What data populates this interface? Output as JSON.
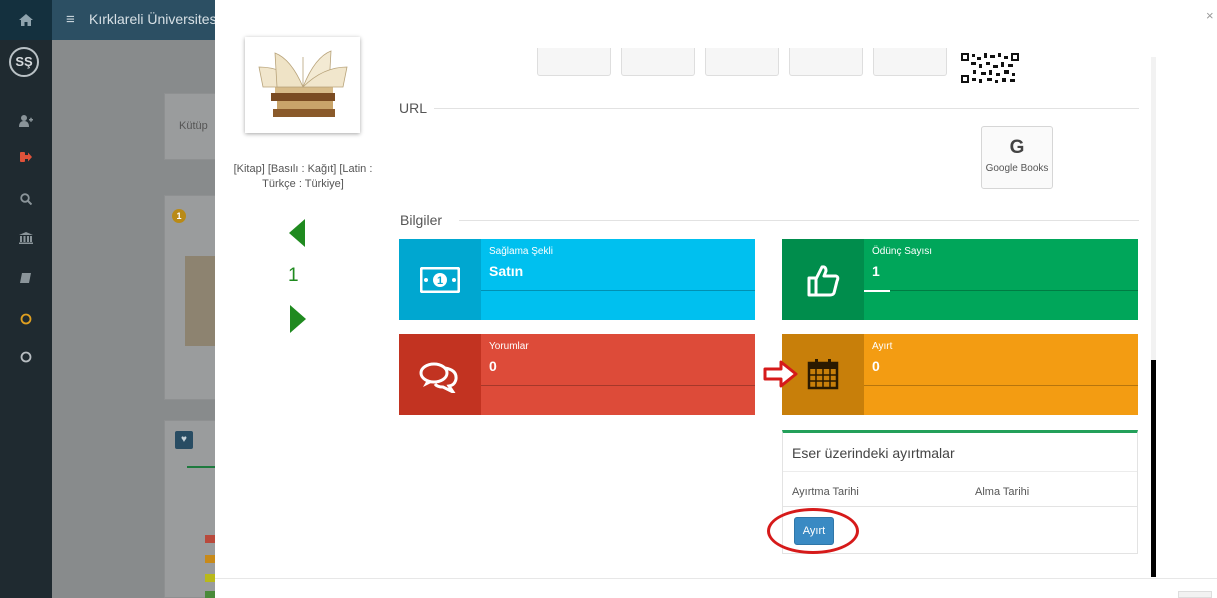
{
  "topbar": {
    "home_icon": "home-icon",
    "menu_icon": "hamburger-icon",
    "title": "Kırklareli Üniversitesi"
  },
  "sidebar": {
    "logo_text": "SŞ",
    "icons": [
      "add-user-icon",
      "logout-icon",
      "search-icon",
      "institution-icon",
      "book-icon",
      "circle-icon",
      "circle-icon"
    ],
    "icon_colors": [
      "#8a9499",
      "#e0523a",
      "#8a9499",
      "#8a9499",
      "#8a9499",
      "#e0a020",
      "#b7bdc1"
    ]
  },
  "background_page": {
    "search_text": "Kütüp",
    "badge_number": "1"
  },
  "book": {
    "format": "[Kitap] [Basılı : Kağıt] [Latin : Türkçe : Türkiye]",
    "page_number": "1"
  },
  "sections": {
    "url_label": "URL",
    "info_label": "Bilgiler"
  },
  "google_books": {
    "logo_letter": "G",
    "label": "Google Books"
  },
  "tiles": [
    {
      "label": "Sağlama Şekli",
      "value": "Satın",
      "color": "#00c0ef",
      "dark": "#00a7d0",
      "icon": "money-bill-icon"
    },
    {
      "label": "Ödünç Sayısı",
      "value": "1",
      "color": "#00a65a",
      "dark": "#008d4c",
      "icon": "thumbs-up-icon"
    },
    {
      "label": "Yorumlar",
      "value": "0",
      "color": "#dd4b39",
      "dark": "#c23321",
      "icon": "comments-icon"
    },
    {
      "label": "Ayırt",
      "value": "0",
      "color": "#f39c12",
      "dark": "#c87f0a",
      "icon": "calendar-icon"
    }
  ],
  "reservations": {
    "title": "Eser üzerindeki ayırtmalar",
    "col_reserve_date": "Ayırtma Tarihi",
    "col_pickup_date": "Alma Tarihi",
    "button_label": "Ayırt"
  },
  "colors": {
    "accent_green": "#1f8a1f",
    "annotation_red": "#d61a1a",
    "panel_border": "#23a05a"
  }
}
